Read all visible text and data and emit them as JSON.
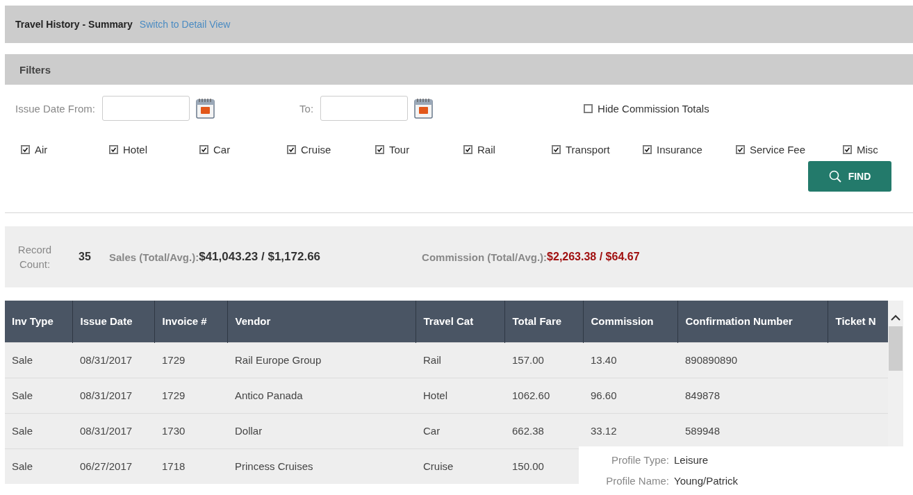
{
  "header": {
    "title": "Travel History - Summary",
    "link": "Switch to Detail View"
  },
  "filters": {
    "title": "Filters",
    "date_from_label": "Issue Date From:",
    "date_to_label": "To:",
    "hide_commission": {
      "label": "Hide Commission Totals",
      "checked": false
    },
    "categories": [
      {
        "label": "Air",
        "checked": true
      },
      {
        "label": "Hotel",
        "checked": true
      },
      {
        "label": "Car",
        "checked": true
      },
      {
        "label": "Cruise",
        "checked": true
      },
      {
        "label": "Tour",
        "checked": true
      },
      {
        "label": "Rail",
        "checked": true
      },
      {
        "label": "Transport",
        "checked": true
      },
      {
        "label": "Insurance",
        "checked": true
      },
      {
        "label": "Service Fee",
        "checked": true
      },
      {
        "label": "Misc",
        "checked": true
      }
    ],
    "find_button": "FIND"
  },
  "summary": {
    "record_count_label": "Record Count:",
    "record_count": "35",
    "sales_label": "Sales (Total/Avg.):",
    "sales_value": "$41,043.23 / $1,172.66",
    "commission_label": "Commission (Total/Avg.):",
    "commission_value": "$2,263.38 / $64.67"
  },
  "table": {
    "columns": [
      "Inv Type",
      "Issue Date",
      "Invoice #",
      "Vendor",
      "Travel Cat",
      "Total Fare",
      "Commission",
      "Confirmation Number",
      "Ticket N"
    ],
    "rows": [
      [
        "Sale",
        "08/31/2017",
        "1729",
        "Rail Europe Group",
        "Rail",
        "157.00",
        "13.40",
        "890890890"
      ],
      [
        "Sale",
        "08/31/2017",
        "1729",
        "Antico Panada",
        "Hotel",
        "1062.60",
        "96.60",
        "849878"
      ],
      [
        "Sale",
        "08/31/2017",
        "1730",
        "Dollar",
        "Car",
        "662.38",
        "33.12",
        "589948"
      ],
      [
        "Sale",
        "06/27/2017",
        "1718",
        "Princess Cruises",
        "Cruise",
        "150.00"
      ]
    ]
  },
  "tooltip": [
    {
      "label": "Profile Type:",
      "value": "Leisure"
    },
    {
      "label": "Profile Name:",
      "value": "Young/Patrick"
    }
  ]
}
